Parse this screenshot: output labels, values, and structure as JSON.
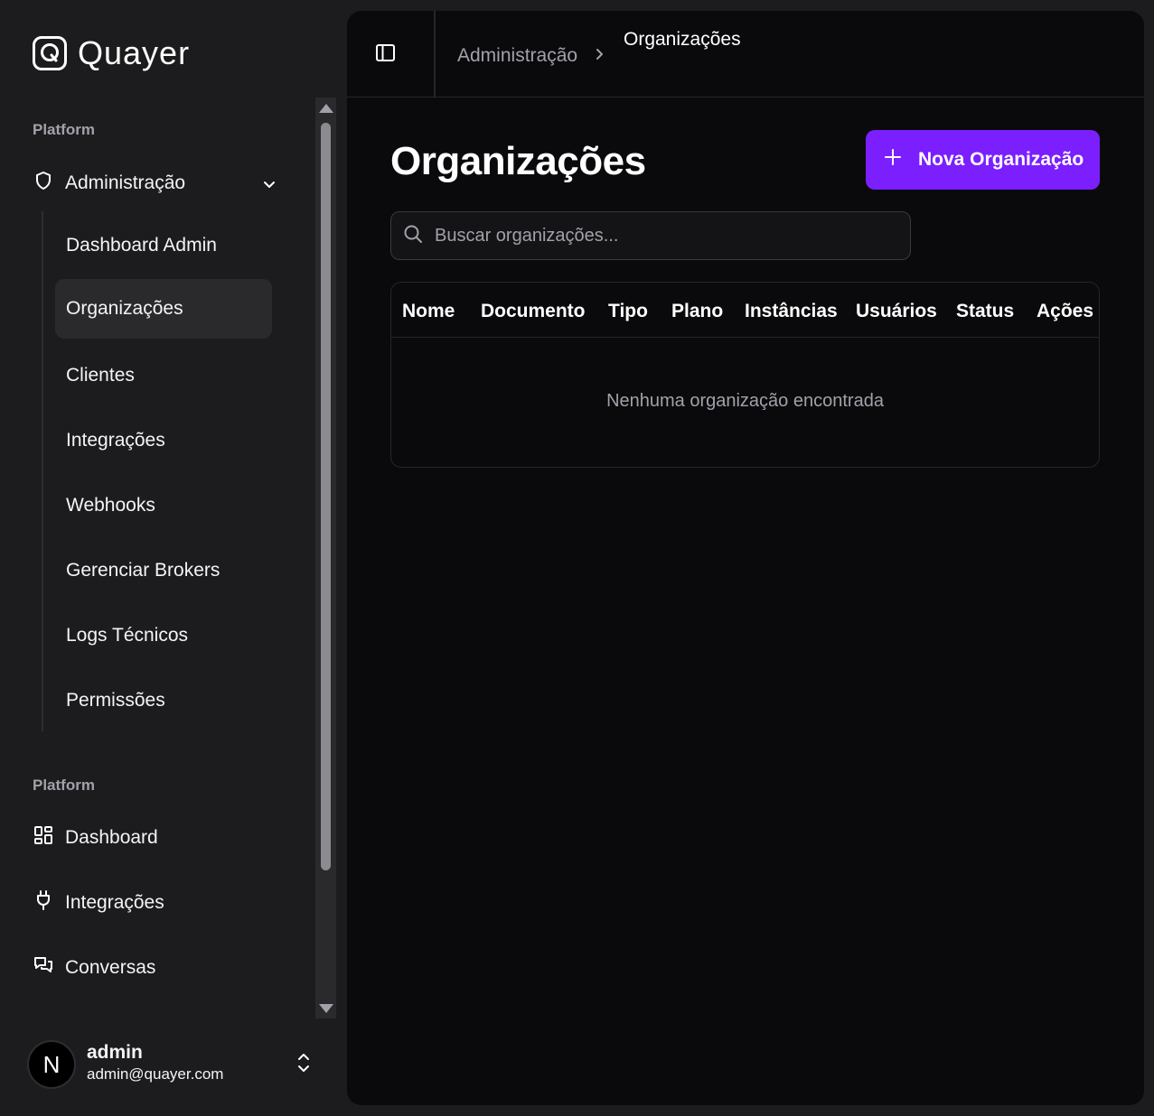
{
  "brand": {
    "name": "Quayer"
  },
  "sidebar": {
    "group1_label": "Platform",
    "parent": {
      "label": "Administração"
    },
    "sub_items": [
      {
        "label": "Dashboard Admin"
      },
      {
        "label": "Organizações",
        "active": true
      },
      {
        "label": "Clientes"
      },
      {
        "label": "Integrações"
      },
      {
        "label": "Webhooks"
      },
      {
        "label": "Gerenciar Brokers"
      },
      {
        "label": "Logs Técnicos"
      },
      {
        "label": "Permissões"
      }
    ],
    "group2_label": "Platform",
    "items": [
      {
        "label": "Dashboard",
        "icon": "dashboard-grid-icon"
      },
      {
        "label": "Integrações",
        "icon": "plug-icon"
      },
      {
        "label": "Conversas",
        "icon": "chat-bubbles-icon"
      }
    ]
  },
  "user": {
    "name": "admin",
    "email": "admin@quayer.com",
    "avatar_initial": "N"
  },
  "breadcrumb": {
    "parent": "Administração",
    "current": "Organizações"
  },
  "page": {
    "title": "Organizações",
    "new_button_label": "Nova Organização",
    "search_placeholder": "Buscar organizações...",
    "search_value": ""
  },
  "table": {
    "columns": [
      "Nome",
      "Documento",
      "Tipo",
      "Plano",
      "Instâncias",
      "Usuários",
      "Status",
      "Ações"
    ],
    "rows": [],
    "empty_message": "Nenhuma organização encontrada"
  },
  "colors": {
    "accent": "#7b1fff",
    "sidebar_bg": "#1c1c1e",
    "main_bg": "#0a0a0c",
    "active_item_bg": "#2a2a2d"
  }
}
